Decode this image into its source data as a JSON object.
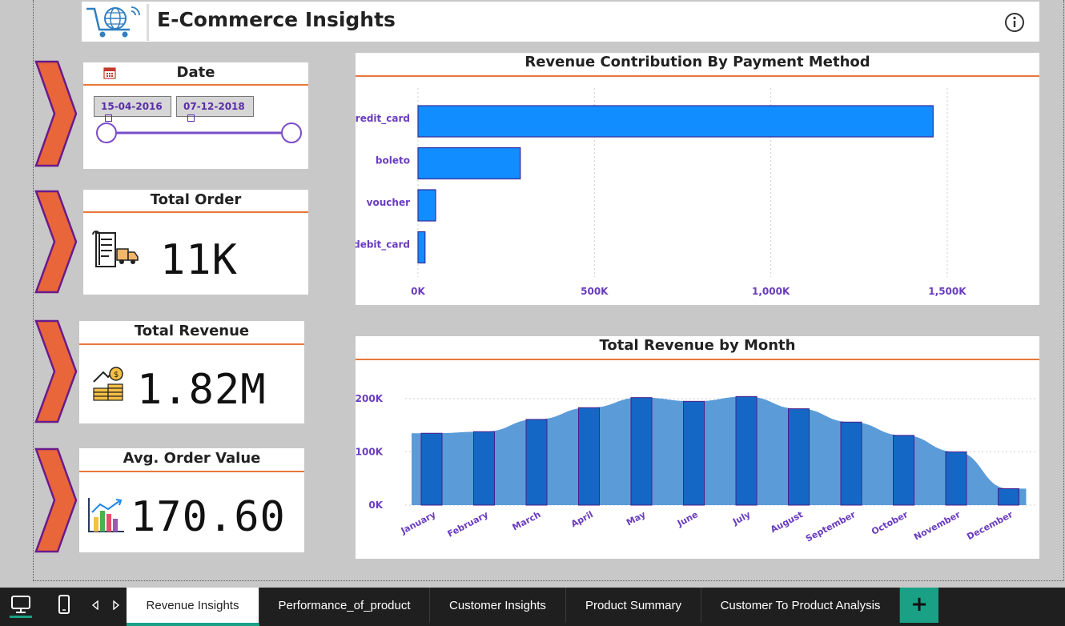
{
  "app": {
    "title": "E-Commerce Insights"
  },
  "filters": {
    "date_title": "Date",
    "start_date": "15-04-2016",
    "end_date": "07-12-2018"
  },
  "kpis": [
    {
      "title": "Total Order",
      "value": "11K"
    },
    {
      "title": "Total Revenue",
      "value": "1.82M"
    },
    {
      "title": "Avg. Order Value",
      "value": "170.60"
    }
  ],
  "chart_data": [
    {
      "type": "bar",
      "orientation": "horizontal",
      "title": "Revenue Contribution By Payment Method",
      "categories": [
        "credit_card",
        "boleto",
        "voucher",
        "debit_card"
      ],
      "values": [
        1460000,
        290000,
        50000,
        20000
      ],
      "xlim": [
        0,
        1600000
      ],
      "ticks": [
        "0K",
        "500K",
        "1,000K",
        "1,500K"
      ],
      "tick_values": [
        0,
        500000,
        1000000,
        1500000
      ],
      "grid": true,
      "bar_color": "#118dff"
    },
    {
      "type": "bar",
      "title": "Total Revenue by Month",
      "categories": [
        "January",
        "February",
        "March",
        "April",
        "May",
        "June",
        "July",
        "August",
        "September",
        "October",
        "November",
        "December"
      ],
      "values": [
        135000,
        138000,
        161000,
        183000,
        202000,
        195000,
        204000,
        181000,
        156000,
        131000,
        100000,
        31000
      ],
      "area_values": [
        135000,
        138000,
        161000,
        183000,
        202000,
        195000,
        204000,
        181000,
        156000,
        131000,
        100000,
        31000
      ],
      "ylim": [
        0,
        200000
      ],
      "ticks": [
        "0K",
        "100K",
        "200K"
      ],
      "tick_values": [
        0,
        100000,
        200000
      ],
      "grid": true,
      "bar_color": "#1467c4",
      "area_color": "#5b9bd8"
    }
  ],
  "tabs": [
    {
      "label": "Revenue Insights",
      "active": true
    },
    {
      "label": "Performance_of_product"
    },
    {
      "label": "Customer Insights"
    },
    {
      "label": "Product Summary"
    },
    {
      "label": "Customer To Product Analysis"
    }
  ],
  "tab_add_label": "+",
  "icons": {
    "desktop": "desktop-view-icon",
    "phone": "phone-view-icon",
    "prev": "prev-page-icon",
    "next": "next-page-icon",
    "info": "info-icon"
  },
  "colors": {
    "accent": "#e8773a",
    "chevron": "#e8663a",
    "chevron_border": "#6a1a8a",
    "teal": "#1aa085",
    "axis_text": "#6a3cc0"
  }
}
